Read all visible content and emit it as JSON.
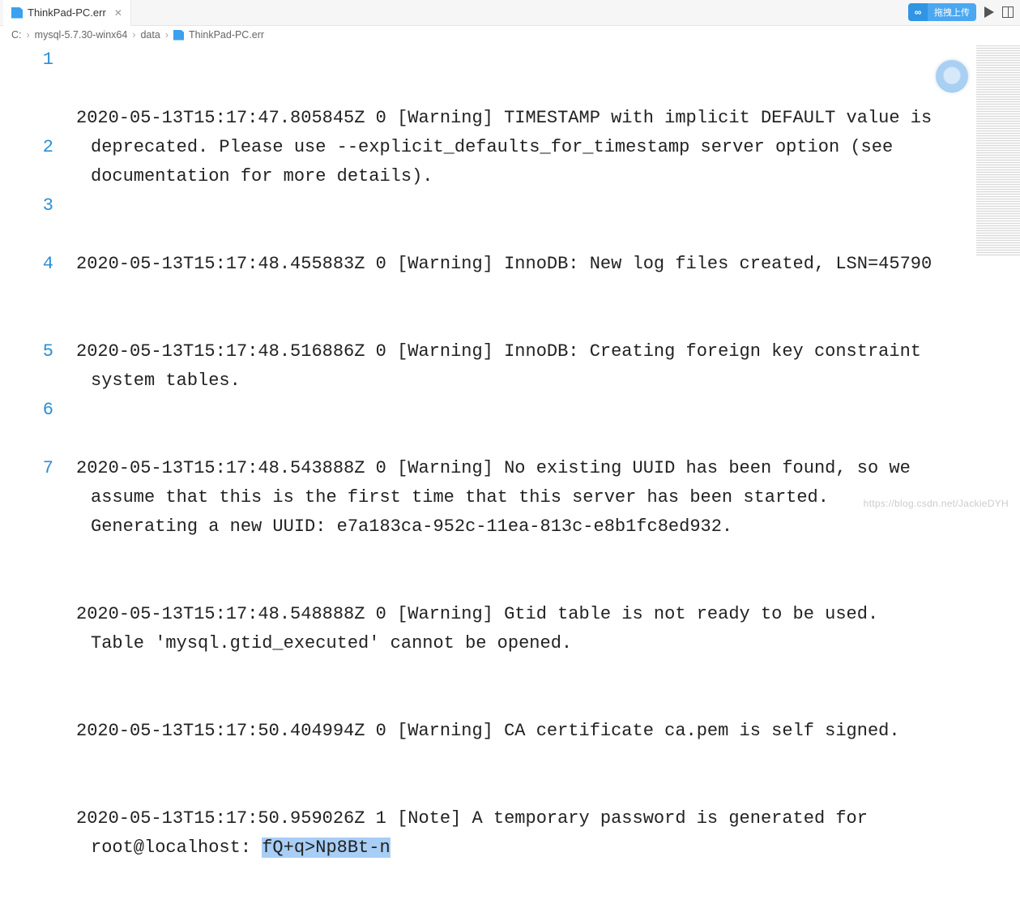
{
  "tab": {
    "title": "ThinkPad-PC.err"
  },
  "toolbar": {
    "upload_label": "拖拽上传"
  },
  "breadcrumb": {
    "seg1": "C:",
    "seg2": "mysql-5.7.30-winx64",
    "seg3": "data",
    "seg4": "ThinkPad-PC.err"
  },
  "lines": {
    "n1": "1",
    "n2": "2",
    "n3": "3",
    "n4": "4",
    "n5": "5",
    "n6": "6",
    "n7": "7"
  },
  "log": {
    "l1": "2020-05-13T15:17:47.805845Z 0 [Warning] TIMESTAMP with implicit DEFAULT value is deprecated. Please use --explicit_defaults_for_timestamp server option (see documentation for more details).",
    "l2": "2020-05-13T15:17:48.455883Z 0 [Warning] InnoDB: New log files created, LSN=45790",
    "l3": "2020-05-13T15:17:48.516886Z 0 [Warning] InnoDB: Creating foreign key constraint system tables.",
    "l4": "2020-05-13T15:17:48.543888Z 0 [Warning] No existing UUID has been found, so we assume that this is the first time that this server has been started. Generating a new UUID: e7a183ca-952c-11ea-813c-e8b1fc8ed932.",
    "l5": "2020-05-13T15:17:48.548888Z 0 [Warning] Gtid table is not ready to be used. Table 'mysql.gtid_executed' cannot be opened.",
    "l6": "2020-05-13T15:17:50.404994Z 0 [Warning] CA certificate ca.pem is self signed.",
    "l7a": "2020-05-13T15:17:50.959026Z 1 [Note] A temporary password is generated for root@localhost: ",
    "l7b": "fQ+q>Np8Bt-n"
  },
  "watermark": "https://blog.csdn.net/JackieDYH"
}
